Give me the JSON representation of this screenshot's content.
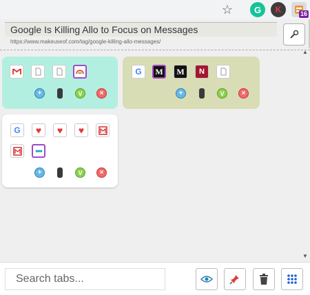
{
  "browser": {
    "extension_badge": "16",
    "icons": [
      "star-icon",
      "grammarly-icon",
      "k-extension-icon",
      "tab-manager-extension-icon"
    ]
  },
  "header": {
    "title": "Google Is Killing Allo to Focus on Messages",
    "url": "https://www.makeuseof.com/tag/google-killing-allo-messages/"
  },
  "windows": [
    {
      "color": "#b3efe0",
      "tabs": [
        "gmail-favicon",
        "blank-page-favicon",
        "blank-page-favicon",
        "rainbow-favicon"
      ]
    },
    {
      "color": "#d8ddb5",
      "tabs": [
        "google-favicon",
        "medium-favicon",
        "medium-favicon",
        "newsbar-favicon",
        "blank-page-favicon"
      ]
    },
    {
      "color": "#ffffff",
      "tabs": [
        "google-favicon",
        "heart-favicon",
        "heart-favicon",
        "heart-favicon",
        "makeuseof-favicon",
        "makeuseof-favicon",
        "more-favicon"
      ]
    }
  ],
  "search": {
    "placeholder": "Search tabs..."
  },
  "toolbar": {
    "icons": [
      "eye-icon",
      "pin-icon",
      "trash-icon",
      "grid-icon"
    ]
  },
  "colors": {
    "active_tab_border": "#a248c9",
    "add": "#69b7e6",
    "v": "#8cd14d",
    "close": "#ee6b6b"
  }
}
